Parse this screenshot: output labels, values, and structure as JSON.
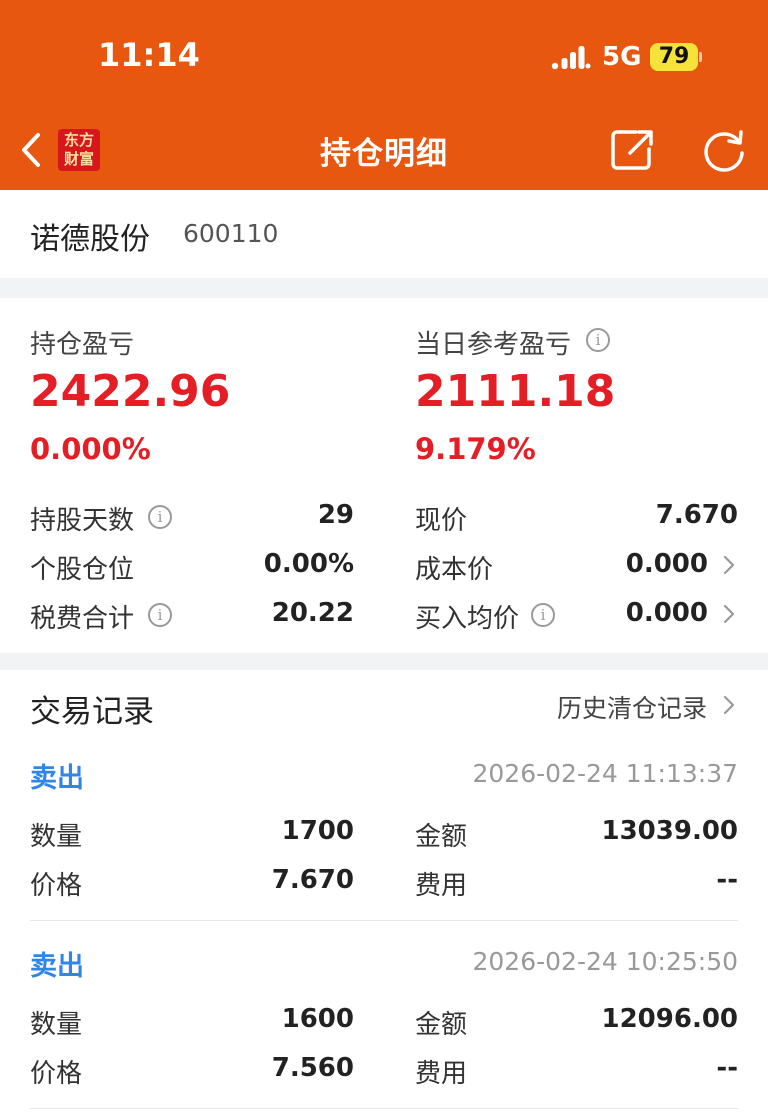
{
  "status_bar": {
    "time": "11:14",
    "network": "5G",
    "battery": "79"
  },
  "nav": {
    "logo_line1": "东方",
    "logo_line2": "财富",
    "title": "持仓明细",
    "icons": {
      "back": "chevron-left-icon",
      "share": "share-icon",
      "refresh": "refresh-icon"
    }
  },
  "stock": {
    "name": "诺德股份",
    "code": "600110"
  },
  "summary": {
    "holding_pl_label": "持仓盈亏",
    "holding_pl_value": "2422.96",
    "holding_pl_percent": "0.000%",
    "daily_pl_label": "当日参考盈亏",
    "daily_pl_value": "2111.18",
    "daily_pl_percent": "9.179%",
    "metrics_left": [
      {
        "label": "持股天数",
        "value": "29"
      },
      {
        "label": "个股仓位",
        "value": "0.00%"
      },
      {
        "label": "税费合计",
        "value": "20.22"
      }
    ],
    "metrics_right": [
      {
        "label": "现价",
        "value": "7.670"
      },
      {
        "label": "成本价",
        "value": "0.000"
      },
      {
        "label": "买入均价",
        "value": "0.000"
      }
    ],
    "accent_color": "#e31e25"
  },
  "trades": {
    "title": "交易记录",
    "history_link": "历史清仓记录",
    "records": [
      {
        "type": "卖出",
        "time": "2026-02-24 11:13:37",
        "quantity_label": "数量",
        "quantity": "1700",
        "amount_label": "金额",
        "amount": "13039.00",
        "price_label": "价格",
        "price": "7.670",
        "fee_label": "费用",
        "fee": "--"
      },
      {
        "type": "卖出",
        "time": "2026-02-24 10:25:50",
        "quantity_label": "数量",
        "quantity": "1600",
        "amount_label": "金额",
        "amount": "12096.00",
        "price_label": "价格",
        "price": "7.560",
        "fee_label": "费用",
        "fee": "--"
      }
    ],
    "type_color": "#2f86e6"
  },
  "colors": {
    "header": "#e8570f",
    "brand_logo": "#d6171c"
  }
}
